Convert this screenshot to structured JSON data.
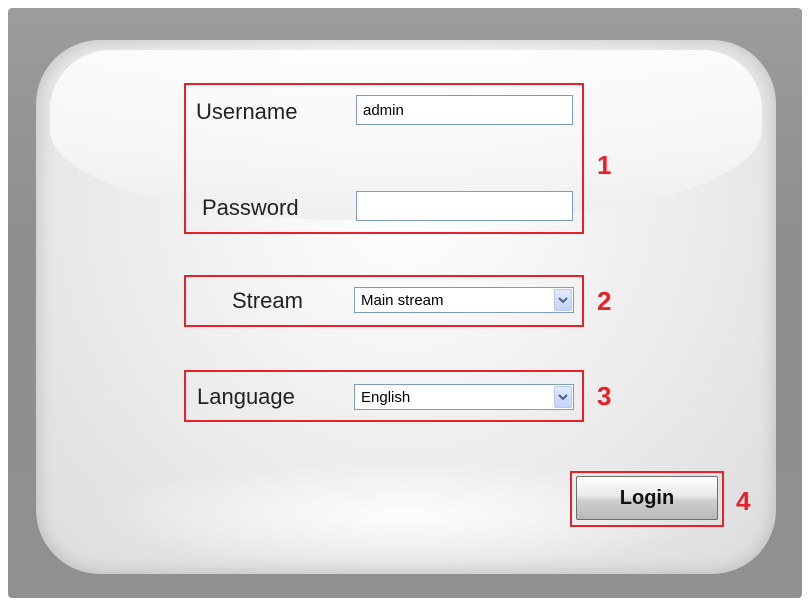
{
  "login_form": {
    "username_label": "Username",
    "username_value": "admin",
    "password_label": "Password",
    "password_value": "",
    "stream_label": "Stream",
    "stream_selected": "Main stream",
    "language_label": "Language",
    "language_selected": "English",
    "login_button": "Login"
  },
  "annotations": {
    "marker_1": "1",
    "marker_2": "2",
    "marker_3": "3",
    "marker_4": "4",
    "accent_color": "#e8202a"
  },
  "icons": {
    "dropdown_arrow": "chevron-down-icon"
  }
}
